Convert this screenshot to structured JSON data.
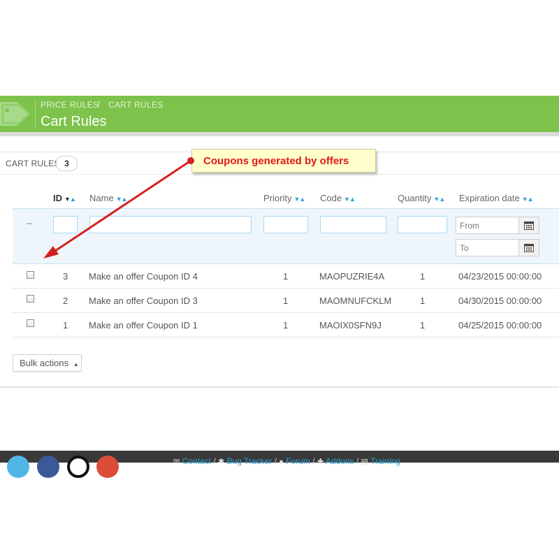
{
  "header": {
    "breadcrumb": [
      "PRICE RULES",
      "CART RULES"
    ],
    "breadcrumb_separator": "/",
    "title": "Cart Rules",
    "color": "#7dc34b"
  },
  "panel": {
    "title": "CART RULES",
    "count": "3"
  },
  "callout": {
    "text": "Coupons generated by offers",
    "color": "#e31818"
  },
  "table": {
    "columns": [
      {
        "key": "id",
        "label": "ID"
      },
      {
        "key": "name",
        "label": "Name"
      },
      {
        "key": "priority",
        "label": "Priority"
      },
      {
        "key": "code",
        "label": "Code"
      },
      {
        "key": "quantity",
        "label": "Quantity"
      },
      {
        "key": "expiration",
        "label": "Expiration date"
      }
    ],
    "filter": {
      "dash": "--",
      "from_placeholder": "From",
      "to_placeholder": "To"
    },
    "rows": [
      {
        "id": "3",
        "name": "Make an offer Coupon ID 4",
        "priority": "1",
        "code": "MAOPUZRIE4A",
        "quantity": "1",
        "expiration": "04/23/2015 00:00:00"
      },
      {
        "id": "2",
        "name": "Make an offer Coupon ID 3",
        "priority": "1",
        "code": "MAOMNUFCKLM",
        "quantity": "1",
        "expiration": "04/30/2015 00:00:00"
      },
      {
        "id": "1",
        "name": "Make an offer Coupon ID 1",
        "priority": "1",
        "code": "MAOIX0SFN9J",
        "quantity": "1",
        "expiration": "04/25/2015 00:00:00"
      }
    ]
  },
  "bulk_actions": {
    "label": "Bulk actions"
  },
  "footer": {
    "links": [
      "Contact",
      "Bug Tracker",
      "Forum",
      "Addons",
      "Training"
    ],
    "social_icons": [
      "twitter-icon",
      "facebook-icon",
      "github-icon",
      "google-plus-icon"
    ]
  }
}
